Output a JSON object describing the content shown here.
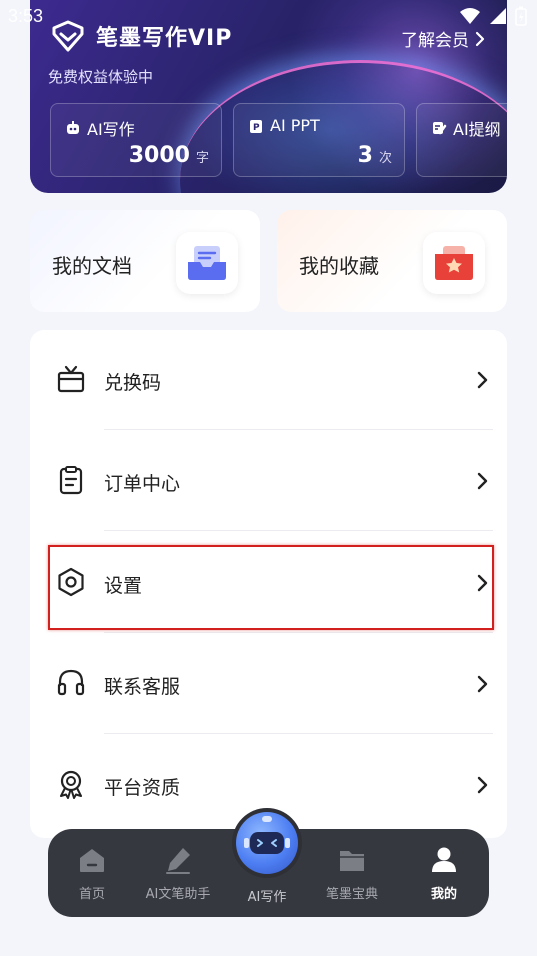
{
  "status_bar": {
    "time": "3:53"
  },
  "vip": {
    "title": "笔墨写作VIP",
    "learn_more": "了解会员",
    "subtitle": "免费权益体验中",
    "benefits": [
      {
        "name": "AI写作",
        "value": "3000",
        "unit": "字",
        "icon": "robot-icon"
      },
      {
        "name": "AI PPT",
        "value": "3",
        "unit": "次",
        "icon": "ppt-icon"
      },
      {
        "name": "AI提纲",
        "value": "",
        "unit": "",
        "icon": "outline-icon"
      }
    ]
  },
  "quick_cards": [
    {
      "label": "我的文档",
      "icon": "document-tray-icon"
    },
    {
      "label": "我的收藏",
      "icon": "favorite-box-icon"
    }
  ],
  "menu": [
    {
      "label": "兑换码",
      "icon": "gift-icon"
    },
    {
      "label": "订单中心",
      "icon": "clipboard-icon"
    },
    {
      "label": "设置",
      "icon": "settings-hexagon-icon"
    },
    {
      "label": "联系客服",
      "icon": "headset-icon"
    },
    {
      "label": "平台资质",
      "icon": "award-icon"
    }
  ],
  "bottom_nav": [
    {
      "label": "首页",
      "icon": "home-icon",
      "active": false
    },
    {
      "label": "AI文笔助手",
      "icon": "pen-icon",
      "active": false
    },
    {
      "label": "AI写作",
      "icon": "robot-face-icon",
      "active": false
    },
    {
      "label": "笔墨宝典",
      "icon": "folder-icon",
      "active": false
    },
    {
      "label": "我的",
      "icon": "user-icon",
      "active": true
    }
  ],
  "colors": {
    "vip_bg": "#2d2572",
    "nav_bg": "#363840",
    "highlight": "#d2201e",
    "doc_accent": "#5a6cf0",
    "fav_accent": "#e8413a"
  }
}
